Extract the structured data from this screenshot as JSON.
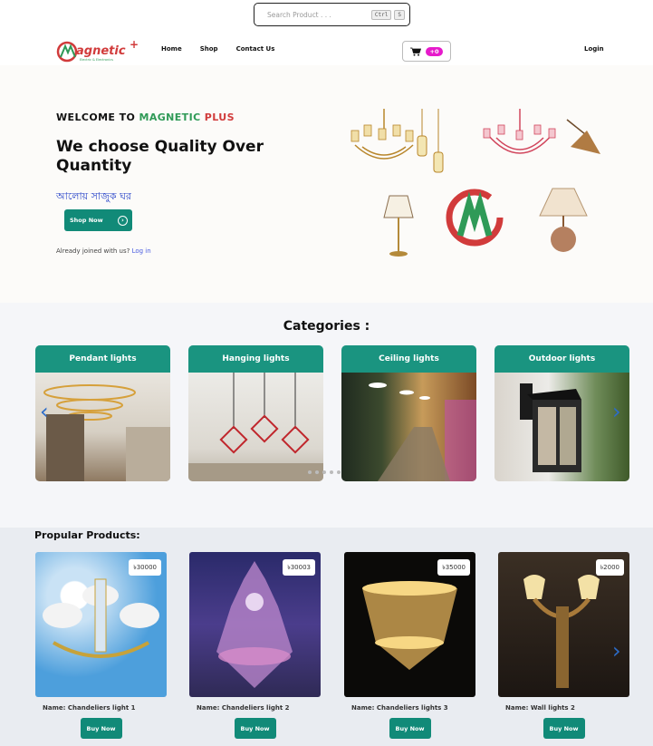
{
  "search": {
    "placeholder": "Search Product . . .",
    "key1": "Ctrl",
    "key2": "S"
  },
  "brand": {
    "name": "Magnetic",
    "plus": "+",
    "tagline": "Electric & Electronics"
  },
  "nav": {
    "home": "Home",
    "shop": "Shop",
    "contact": "Contact Us",
    "login": "Login",
    "cart_count": "+0"
  },
  "hero": {
    "welcome_prefix": "WELCOME TO ",
    "welcome_brand1": "MAGNETIC",
    "welcome_brand2": " PLUS",
    "headline": "We choose Quality Over Quantity",
    "bangla": "আলোয় সাজুক ঘর",
    "shop_now": "Shop Now",
    "joined_text": "Already joined with us? ",
    "login_link": "Log in"
  },
  "categories": {
    "title": "Categories :",
    "items": [
      {
        "label": "Pendant lights"
      },
      {
        "label": "Hanging lights"
      },
      {
        "label": "Ceiling lights"
      },
      {
        "label": "Outdoor lights"
      }
    ]
  },
  "popular": {
    "title": "Propular Products:",
    "products": [
      {
        "name": "Name: Chandeliers light 1",
        "price": "৳30000",
        "buy": "Buy Now"
      },
      {
        "name": "Name: Chandeliers light 2",
        "price": "৳30003",
        "buy": "Buy Now"
      },
      {
        "name": "Name: Chandeliers lights 3",
        "price": "৳35000",
        "buy": "Buy Now"
      },
      {
        "name": "Name: Wall lights 2",
        "price": "৳2000",
        "buy": "Buy Now"
      }
    ]
  },
  "colors": {
    "accent": "#118a78",
    "brand_green": "#2f9a57",
    "brand_red": "#d13b3b",
    "badge": "#e61acb"
  }
}
